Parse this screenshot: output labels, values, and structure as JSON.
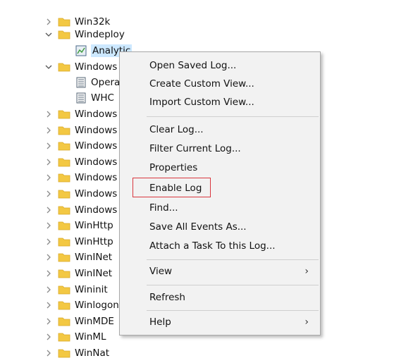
{
  "tree": {
    "items": [
      {
        "label": "Win32k",
        "state": "collapsed"
      },
      {
        "label": "Windeploy",
        "state": "expanded"
      },
      {
        "label": "Analytic",
        "state": "log-selected"
      },
      {
        "label": "Windows",
        "state": "expanded"
      },
      {
        "label": "Opera",
        "state": "log"
      },
      {
        "label": "WHC",
        "state": "log"
      },
      {
        "label": "Windows",
        "state": "collapsed"
      },
      {
        "label": "Windows",
        "state": "collapsed"
      },
      {
        "label": "Windows",
        "state": "collapsed"
      },
      {
        "label": "Windows",
        "state": "collapsed"
      },
      {
        "label": "Windows",
        "state": "collapsed"
      },
      {
        "label": "Windows",
        "state": "collapsed"
      },
      {
        "label": "Windows",
        "state": "collapsed"
      },
      {
        "label": "WinHttp",
        "state": "collapsed"
      },
      {
        "label": "WinHttp",
        "state": "collapsed"
      },
      {
        "label": "WinINet",
        "state": "collapsed"
      },
      {
        "label": "WinINet",
        "state": "collapsed"
      },
      {
        "label": "Wininit",
        "state": "collapsed"
      },
      {
        "label": "Winlogon",
        "state": "collapsed"
      },
      {
        "label": "WinMDE",
        "state": "collapsed"
      },
      {
        "label": "WinML",
        "state": "collapsed"
      },
      {
        "label": "WinNat",
        "state": "collapsed"
      }
    ]
  },
  "context_menu": {
    "open_saved_log": "Open Saved Log...",
    "create_custom_view": "Create Custom View...",
    "import_custom_view": "Import Custom View...",
    "clear_log": "Clear Log...",
    "filter_current_log": "Filter Current Log...",
    "properties": "Properties",
    "enable_log": "Enable Log",
    "find": "Find...",
    "save_all_events_as": "Save All Events As...",
    "attach_task": "Attach a Task To this Log...",
    "view": "View",
    "refresh": "Refresh",
    "help": "Help",
    "submenu_arrow": "›"
  },
  "colors": {
    "highlight_border": "#d9363e",
    "selection_bg": "#cce8ff",
    "folder_yellow": "#f3c843"
  }
}
